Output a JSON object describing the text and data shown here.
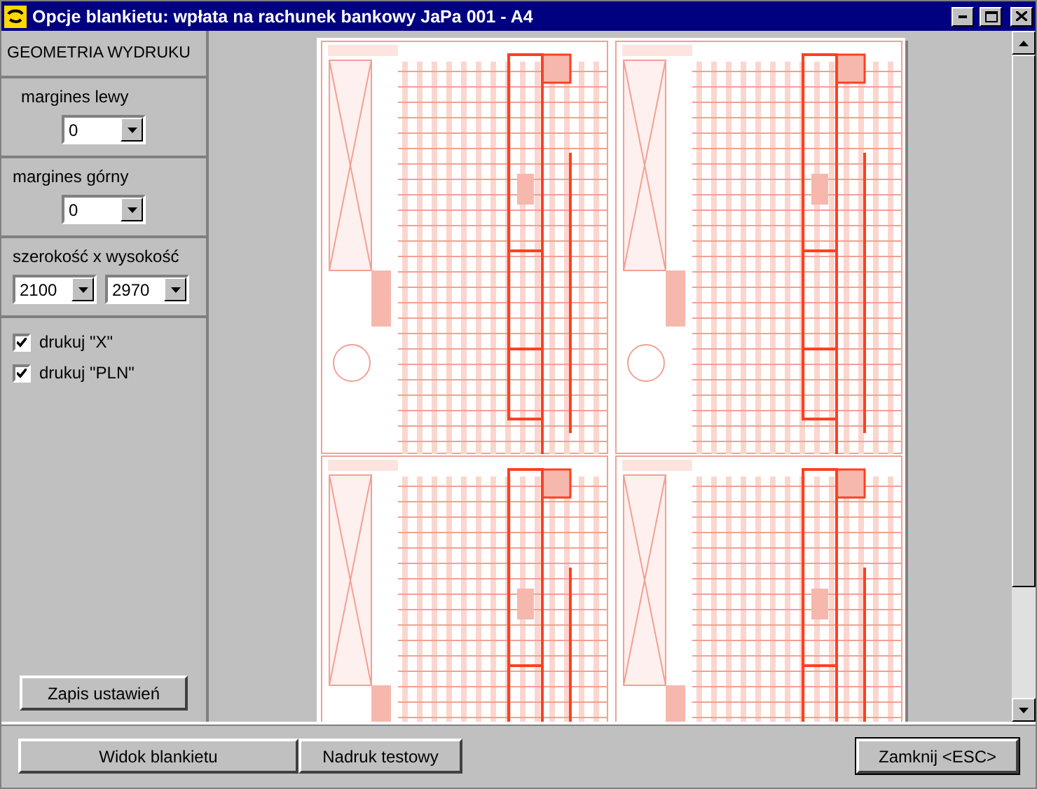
{
  "window": {
    "title": "Opcje blankietu: wpłata na rachunek bankowy JaPa 001 - A4"
  },
  "sidebar": {
    "heading": "GEOMETRIA WYDRUKU",
    "groups": [
      {
        "kind": "single",
        "label": "margines lewy",
        "fields": [
          {
            "value": "0"
          }
        ]
      },
      {
        "kind": "single",
        "label": "margines górny",
        "fields": [
          {
            "value": "0"
          }
        ]
      },
      {
        "kind": "pair",
        "label": "szerokość  x  wysokość",
        "fields": [
          {
            "value": "2100"
          },
          {
            "value": "2970"
          }
        ]
      }
    ],
    "checkboxes": [
      {
        "label": "drukuj \"X\"",
        "checked": true
      },
      {
        "label": "drukuj \"PLN\"",
        "checked": true
      }
    ],
    "save_button": "Zapis ustawień"
  },
  "footer": {
    "left_buttons": [
      {
        "label": "Widok blankietu",
        "selected": false
      },
      {
        "label": "Nadruk testowy",
        "selected": false
      }
    ],
    "close_button": "Zamknij <ESC>"
  }
}
